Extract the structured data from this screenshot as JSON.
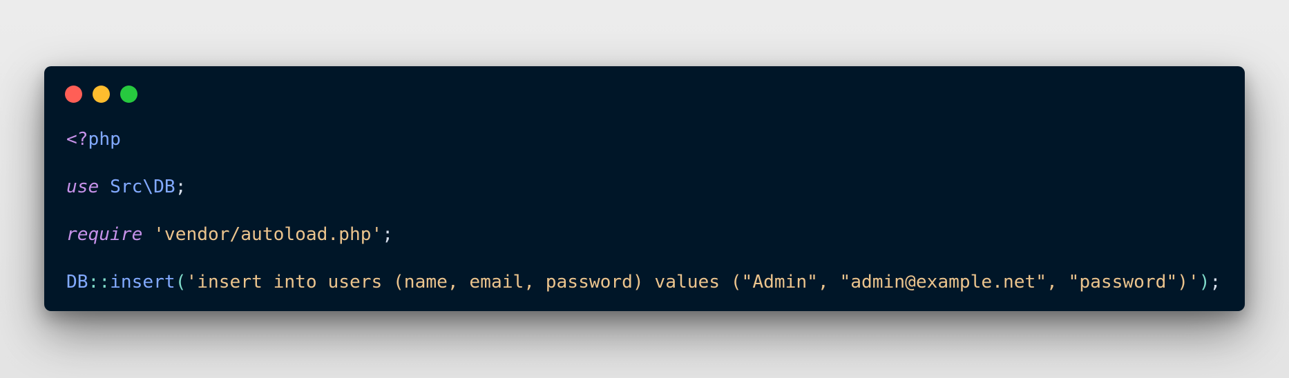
{
  "window": {
    "control_colors": {
      "close": "#ff5f56",
      "minimize": "#ffbd2e",
      "zoom": "#27c93f"
    },
    "background": "#001628"
  },
  "code": {
    "language": "php",
    "line1": {
      "open_tag": "<?",
      "keyword": "php"
    },
    "line2": {
      "keyword": "use",
      "namespace": "Src\\DB",
      "end": ";"
    },
    "line3": {
      "keyword": "require",
      "string": "'vendor/autoload.php'",
      "end": ";"
    },
    "line4": {
      "class": "DB",
      "operator": "::",
      "method": "insert",
      "open": "(",
      "string": "'insert into users (name, email, password) values (\"Admin\", \"admin@example.net\", \"password\")'",
      "close": ")",
      "end": ";"
    }
  }
}
